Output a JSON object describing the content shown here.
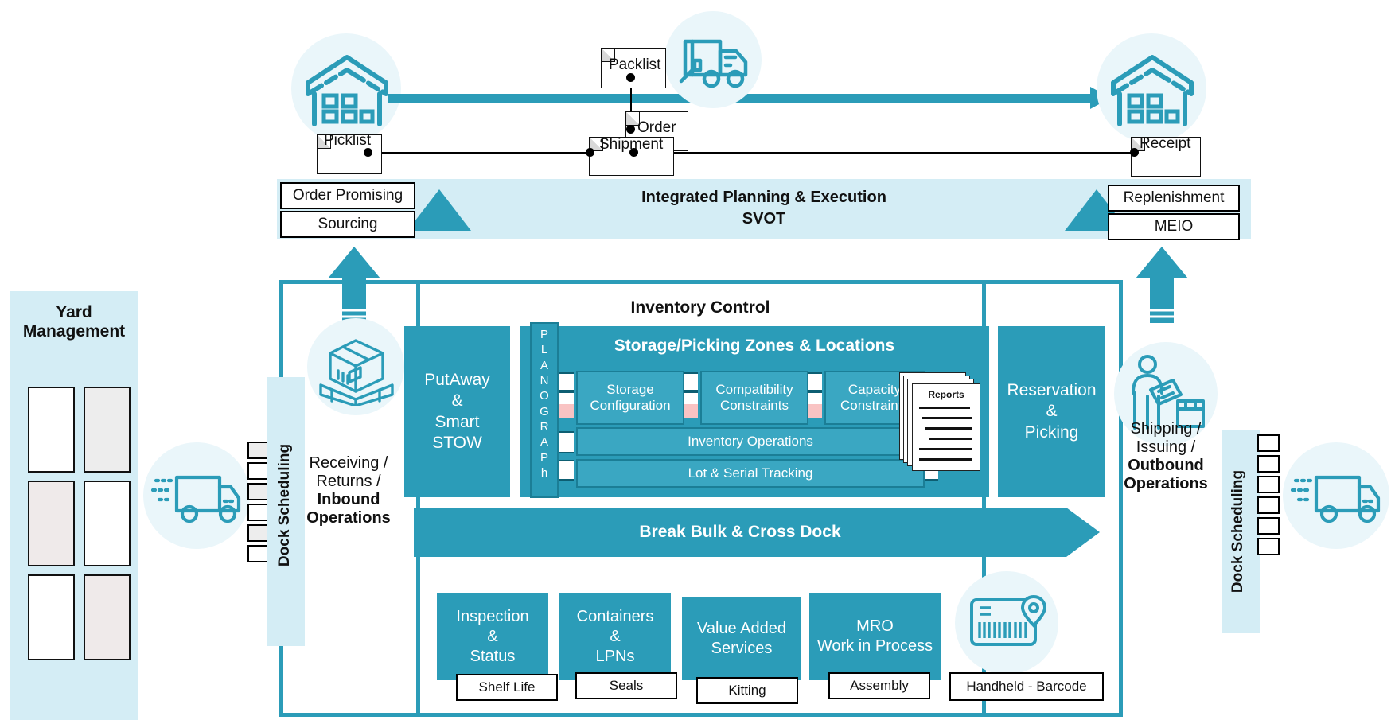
{
  "colors": {
    "teal": "#2B9CB8",
    "teal_light": "#3AA7C2",
    "pale_blue": "#D4EDF5",
    "palest_blue": "#EAF6FA",
    "pink": "#F9C3C3",
    "black": "#000000",
    "white": "#FFFFFF"
  },
  "flow": {
    "source_warehouse_icon": "warehouse-icon",
    "truck_icon": "delivery-truck-icon",
    "dest_warehouse_icon": "warehouse-icon",
    "documents": [
      {
        "label": "Packlist"
      },
      {
        "label": "Order"
      },
      {
        "label": "Picklist"
      },
      {
        "label": "Shipment"
      },
      {
        "label": "Receipt"
      }
    ]
  },
  "planning_band": {
    "title_line1": "Integrated Planning & Execution",
    "title_line2": "SVOT",
    "left_boxes": [
      {
        "label": "Order Promising"
      },
      {
        "label": "Sourcing"
      }
    ],
    "right_boxes": [
      {
        "label": "Replenishment"
      },
      {
        "label": "MEIO"
      }
    ]
  },
  "yard": {
    "title_line1": "Yard",
    "title_line2": "Management",
    "slot_count": 6
  },
  "inbound": {
    "dock_label": "Dock Scheduling",
    "icon": "pallet-box-icon",
    "truck_icon": "fast-truck-icon",
    "line1": "Receiving /",
    "line2": "Returns /",
    "line3": "Inbound",
    "line4": "Operations"
  },
  "outbound": {
    "dock_label": "Dock Scheduling",
    "icon": "worker-clipboard-icon",
    "truck_icon": "fast-truck-icon",
    "line1": "Shipping /",
    "line2": "Issuing /",
    "line3": "Outbound",
    "line4": "Operations"
  },
  "inventory_control": {
    "title": "Inventory Control",
    "putaway": {
      "line1": "PutAway",
      "line2": "&",
      "line3": "Smart",
      "line4": "STOW"
    },
    "planograph_letters": [
      "P",
      "L",
      "A",
      "N",
      "O",
      "G",
      "R",
      "A",
      "P",
      "h"
    ],
    "zones_title": "Storage/Picking Zones & Locations",
    "zone_boxes": [
      {
        "line1": "Storage",
        "line2": "Configuration"
      },
      {
        "line1": "Compatibility",
        "line2": "Constraints"
      },
      {
        "line1": "Capacity",
        "line2": "Constraints"
      }
    ],
    "rows": [
      {
        "label": "Inventory Operations"
      },
      {
        "label": "Lot & Serial Tracking"
      }
    ],
    "reports_label": "Reports",
    "reservation": {
      "line1": "Reservation",
      "line2": "&",
      "line3": "Picking"
    },
    "break_bulk": "Break Bulk & Cross Dock",
    "bottom_boxes": [
      {
        "line1": "Inspection",
        "line2": "&",
        "line3": "Status",
        "sub": "Shelf Life"
      },
      {
        "line1": "Containers",
        "line2": "&",
        "line3": "LPNs",
        "sub": "Seals"
      },
      {
        "line1": "Value Added",
        "line2": "Services",
        "line3": "",
        "sub": "Kitting"
      },
      {
        "line1": "MRO",
        "line2": "Work in Process",
        "line3": "",
        "sub": "Assembly"
      }
    ],
    "handheld": {
      "icon": "barcode-scanner-icon",
      "label": "Handheld - Barcode"
    }
  }
}
